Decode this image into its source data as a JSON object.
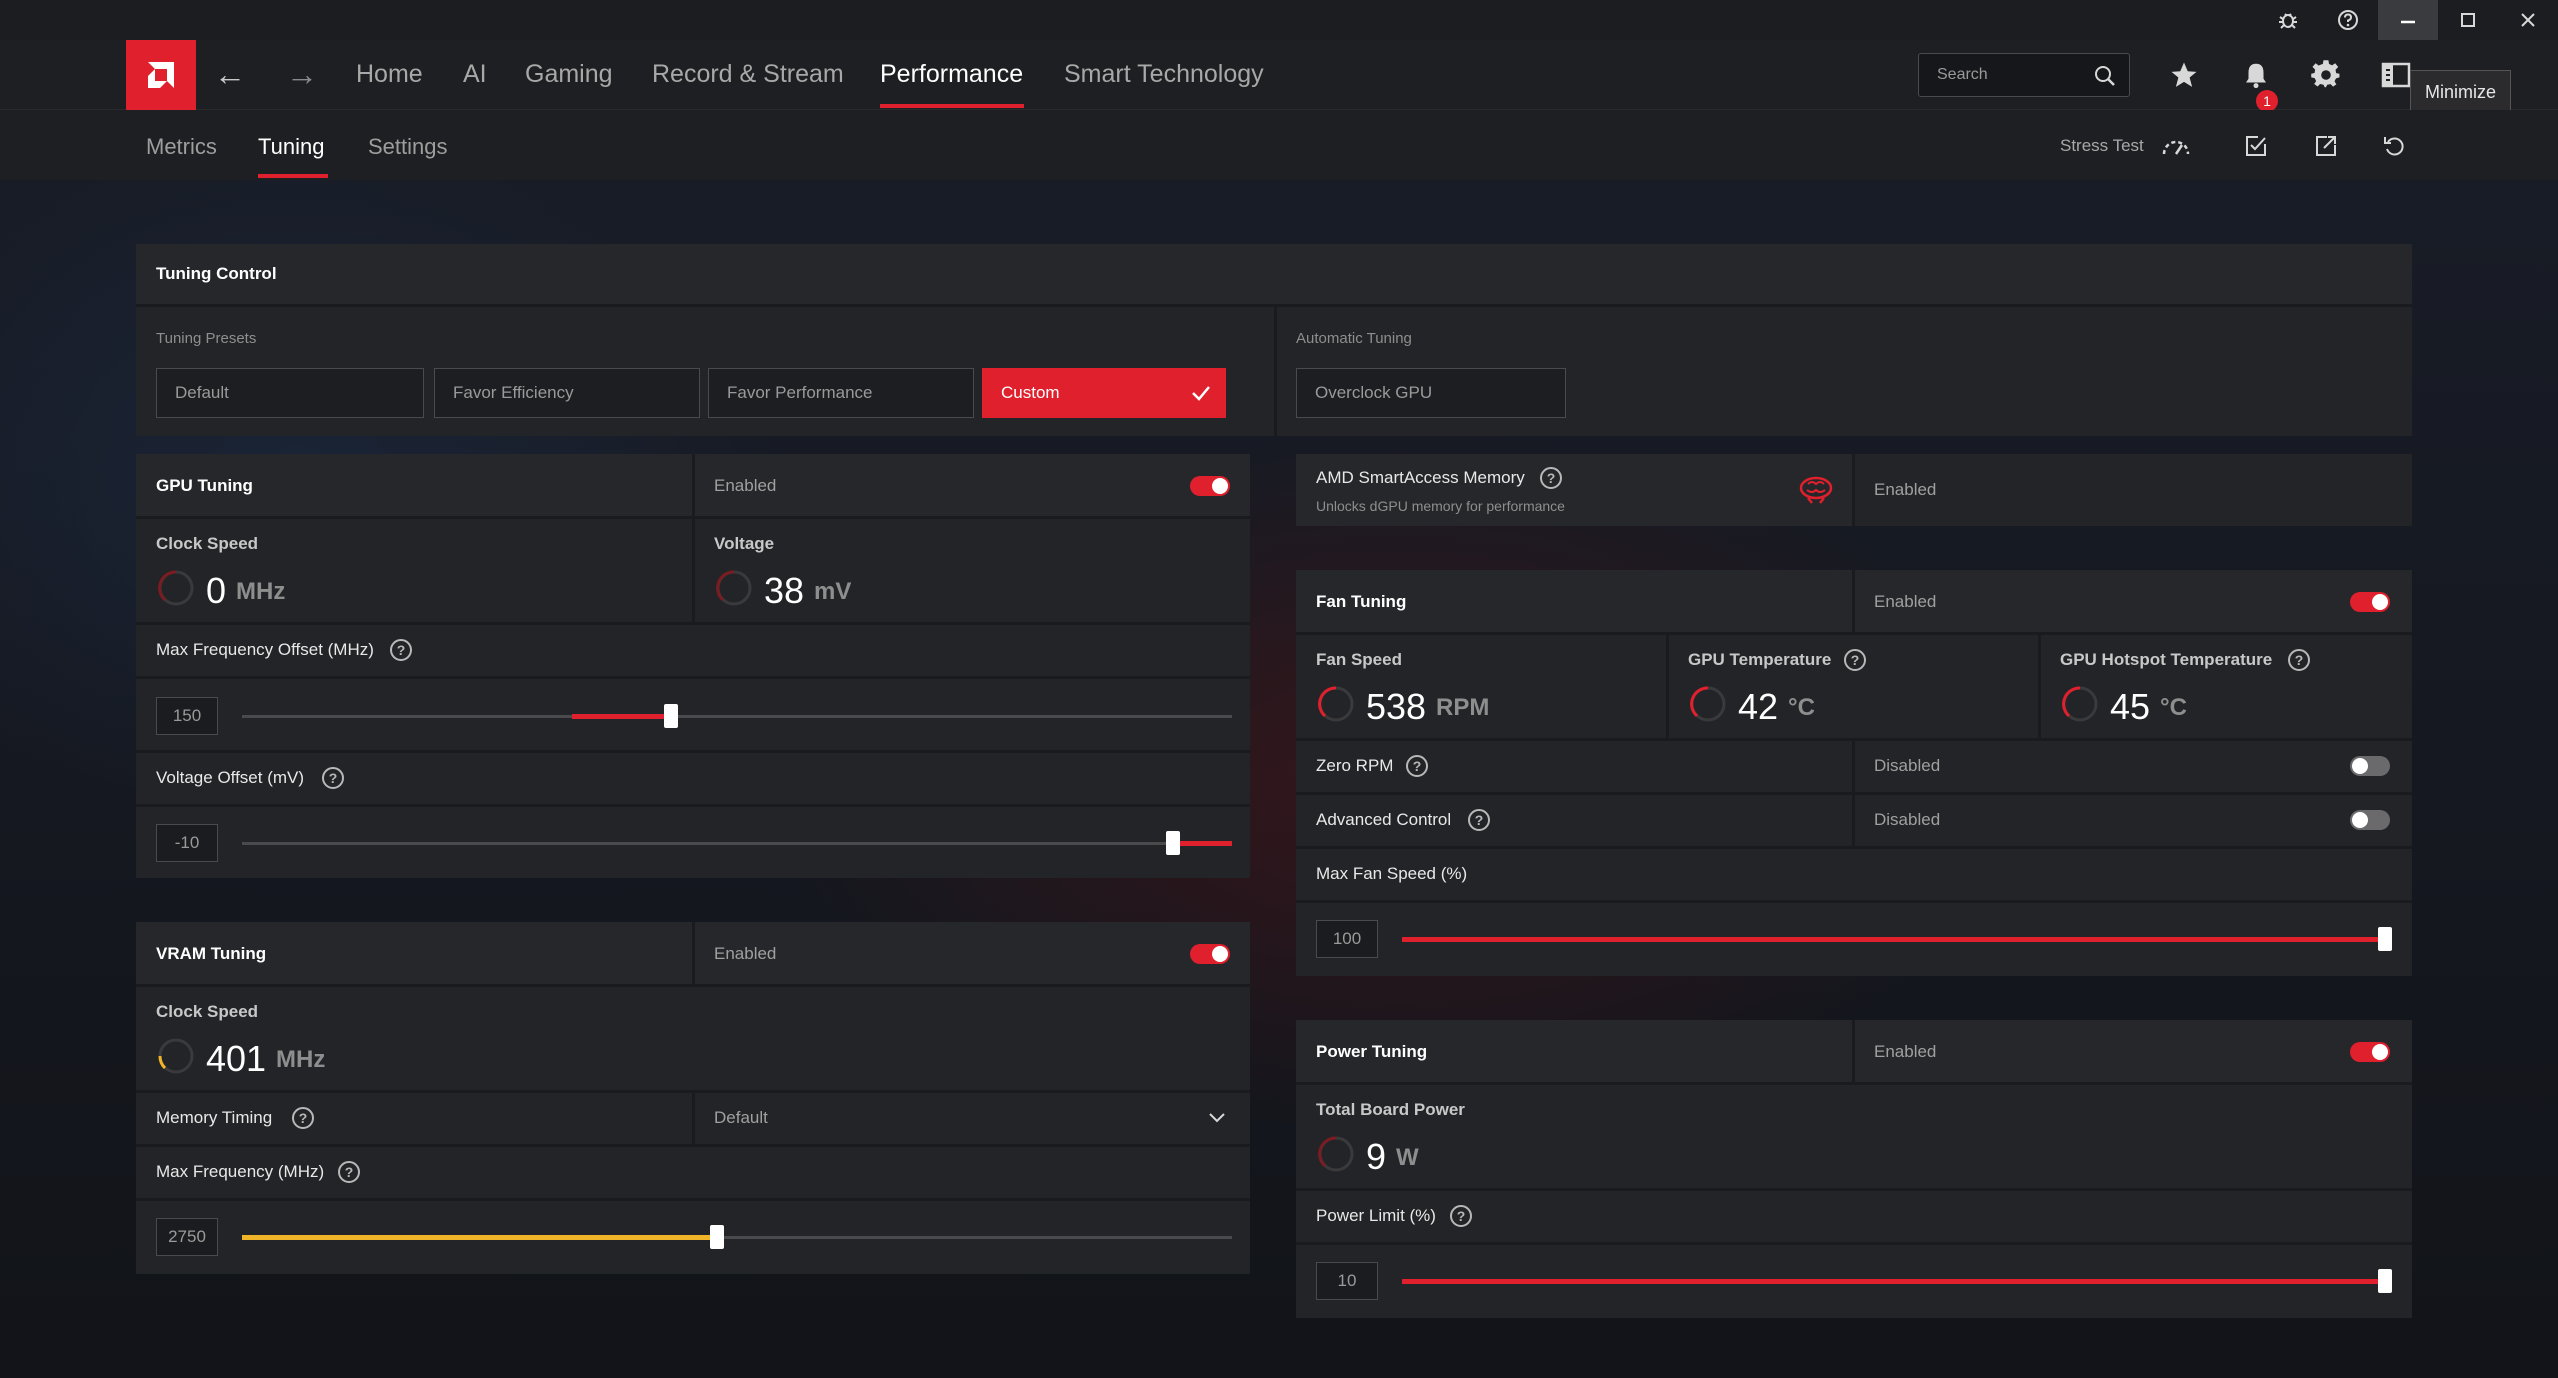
{
  "colors": {
    "accent": "#e0202c",
    "vram_accent": "#f0b429",
    "panel": "#232427"
  },
  "titlebar": {
    "tooltip": "Minimize",
    "icons": [
      "bug-icon",
      "help-icon",
      "minimize-icon",
      "maximize-icon",
      "close-icon"
    ]
  },
  "nav": {
    "items": [
      "Home",
      "AI",
      "Gaming",
      "Record & Stream",
      "Performance",
      "Smart Technology"
    ],
    "active": "Performance",
    "search_placeholder": "Search",
    "notification_count": "1"
  },
  "subnav": {
    "tabs": [
      "Metrics",
      "Tuning",
      "Settings"
    ],
    "active": "Tuning",
    "stress_test": "Stress Test"
  },
  "tuning_control": {
    "title": "Tuning Control",
    "presets_label": "Tuning Presets",
    "presets": [
      "Default",
      "Favor Efficiency",
      "Favor Performance",
      "Custom"
    ],
    "selected_preset": "Custom",
    "auto_label": "Automatic Tuning",
    "auto_button": "Overclock GPU"
  },
  "gpu_tuning": {
    "title": "GPU Tuning",
    "status": "Enabled",
    "enabled": true,
    "clock_label": "Clock Speed",
    "clock_value": "0",
    "clock_unit": "MHz",
    "voltage_label": "Voltage",
    "voltage_value": "38",
    "voltage_unit": "mV",
    "max_freq_label": "Max Frequency Offset (MHz)",
    "max_freq_value": "150",
    "voltage_offset_label": "Voltage Offset (mV)",
    "voltage_offset_value": "-10"
  },
  "vram_tuning": {
    "title": "VRAM Tuning",
    "status": "Enabled",
    "enabled": true,
    "clock_label": "Clock Speed",
    "clock_value": "401",
    "clock_unit": "MHz",
    "memory_timing_label": "Memory Timing",
    "memory_timing_value": "Default",
    "max_freq_label": "Max Frequency (MHz)",
    "max_freq_value": "2750"
  },
  "smart_access": {
    "title": "AMD SmartAccess Memory",
    "subtitle": "Unlocks dGPU memory for performance",
    "status": "Enabled"
  },
  "fan_tuning": {
    "title": "Fan Tuning",
    "status": "Enabled",
    "enabled": true,
    "fan_speed_label": "Fan Speed",
    "fan_speed_value": "538",
    "fan_speed_unit": "RPM",
    "gpu_temp_label": "GPU Temperature",
    "gpu_temp_value": "42",
    "gpu_temp_unit": "°C",
    "hotspot_label": "GPU Hotspot Temperature",
    "hotspot_value": "45",
    "hotspot_unit": "°C",
    "zero_rpm_label": "Zero RPM",
    "zero_rpm_status": "Disabled",
    "advanced_label": "Advanced Control",
    "advanced_status": "Disabled",
    "max_fan_label": "Max Fan Speed (%)",
    "max_fan_value": "100"
  },
  "power_tuning": {
    "title": "Power Tuning",
    "status": "Enabled",
    "enabled": true,
    "board_power_label": "Total Board Power",
    "board_power_value": "9",
    "board_power_unit": "W",
    "power_limit_label": "Power Limit (%)",
    "power_limit_value": "10"
  }
}
